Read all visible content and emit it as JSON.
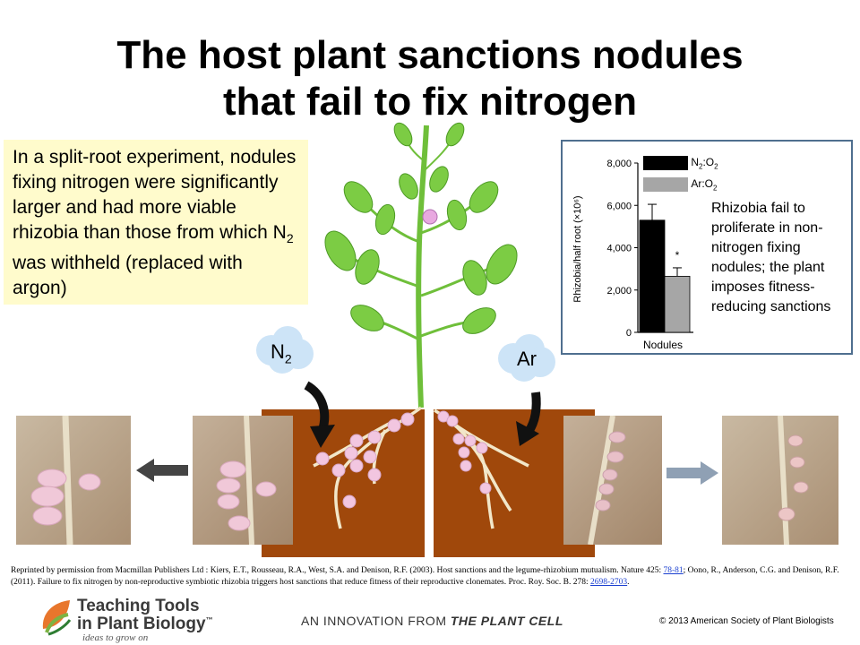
{
  "title": {
    "line1": "The host plant sanctions nodules",
    "line2": "that fail to fix nitrogen"
  },
  "experiment_text": {
    "before_sub": "In a split-root experiment, nodules fixing nitrogen were significantly larger and had more viable rhizobia than those from which N",
    "sub": "2",
    "after_sub": " was withheld (replaced with argon)"
  },
  "labels": {
    "n2_main": "N",
    "n2_sub": "2",
    "ar": "Ar"
  },
  "chart_caption": "Rhizobia fail to proliferate in non-nitrogen fixing nodules; the plant imposes fitness-reducing sanctions",
  "chart_data": {
    "type": "bar",
    "ylabel": "Rhizobia/half root (×10⁶)",
    "xlabel": "Nodules",
    "ylim": [
      0,
      8000
    ],
    "yticks": [
      "0",
      "2,000",
      "4,000",
      "6,000",
      "8,000"
    ],
    "series": [
      {
        "name": "N2:O2",
        "value": 5300,
        "error": 750,
        "color": "#000000"
      },
      {
        "name": "Ar:O2",
        "value": 2650,
        "error": 400,
        "color": "#a6a6a6"
      }
    ],
    "annotation": "*"
  },
  "legend": {
    "n2o2_a": "N",
    "n2o2_sub1": "2",
    "n2o2_b": ":O",
    "n2o2_sub2": "2",
    "aro2_a": "Ar:O",
    "aro2_sub": "2"
  },
  "reference": {
    "text1": "Reprinted by permission from Macmillan Publishers Ltd : Kiers, E.T., Rousseau, R.A., West, S.A. and Denison, R.F. (2003). Host sanctions and the  legume-rhizobium mutualism. Nature 425: ",
    "link1": "78-81",
    "text2": "; Oono, R., Anderson, C.G. and Denison, R.F. (2011). Failure to fix nitrogen by non-reproductive symbiotic rhizobia triggers host sanctions that reduce fitness of their reproductive clonemates. Proc. Roy. Soc. B. 278: ",
    "link2": "2698-2703",
    "text3": "."
  },
  "footer": {
    "logo_line1": "Teaching Tools",
    "logo_line2": "in Plant Biology",
    "logo_tm": "™",
    "logo_tagline": "ideas to grow on",
    "innovation_prefix": "AN INNOVATION FROM ",
    "innovation_brand": "THE PLANT CELL",
    "copyright": "© 2013 American Society of Plant Biologists"
  },
  "colors": {
    "soil": "#a0480b",
    "plant_green": "#6fbf3a",
    "nodule_pink": "#f2c6e0",
    "cloud": "#cde4f7",
    "box_yellow": "#fffbcc",
    "frame_blue": "#4f6f8f"
  }
}
